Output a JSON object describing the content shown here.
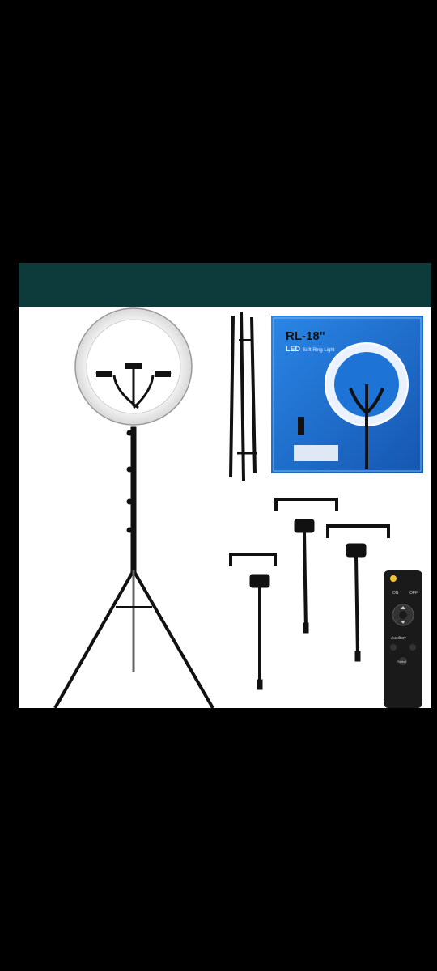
{
  "product_box": {
    "model": "RL-18\"",
    "led_label": "LED",
    "subtitle": "Soft Ring Light"
  },
  "remote": {
    "auxiliary_label": "Auxiliary",
    "on_label": "ON",
    "off_label": "OFF",
    "select_label": "Select"
  },
  "colors": {
    "teal_bar": "#0d3b3b",
    "box_blue": "#1e73d6",
    "ring_light": "#f5f5f5",
    "stand_black": "#111111"
  }
}
